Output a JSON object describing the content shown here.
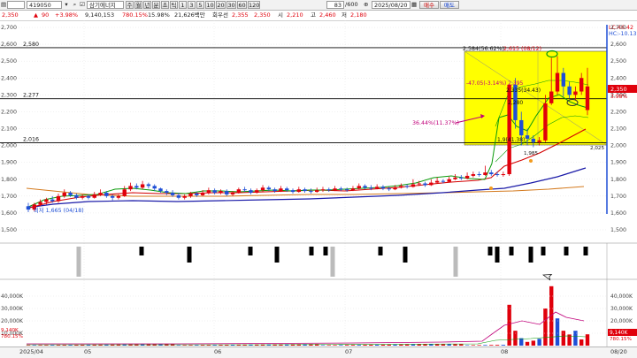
{
  "toolbar": {
    "prefix": "",
    "code": "419050",
    "name": "삼기에너지",
    "period_buttons": [
      "주",
      "월",
      "년",
      "분",
      "초",
      "틱",
      "1",
      "3",
      "5",
      "10",
      "20",
      "30",
      "60",
      "120"
    ],
    "count_value": "83",
    "count_total": "/600",
    "date_value": "2025/08/20",
    "buy_label": "매수",
    "sell_label": "매도",
    "search_icon": "search-icon",
    "calendar_icon": "calendar-icon"
  },
  "infobar": {
    "price": "2,350",
    "change_sign": "▲",
    "change": "90",
    "change_pct": "+3.98%",
    "volume": "9,140,153",
    "turnover_pct": "780.15%",
    "foreign_pct": "15.98%",
    "amount": "21,626백만",
    "deferred_label": "회우선",
    "deferred_value": "2,355",
    "current": "2,350",
    "open_label": "시",
    "open": "2,210",
    "high_label": "고",
    "high": "2,460",
    "low_label": "저",
    "low": "2,180"
  },
  "indicators": {
    "lc": "LC:46.42",
    "hc": "HC:-10.13"
  },
  "price_axis": {
    "ticks": [
      "2,700",
      "2,600",
      "2,500",
      "2,400",
      "2,300",
      "2,200",
      "2,100",
      "2,000",
      "1,900",
      "1,800",
      "1,700",
      "1,600",
      "1,500"
    ],
    "current_label": "2,350",
    "current_pct": "3.98%",
    "low_mark": "2,025"
  },
  "hlines": [
    {
      "label": "2,580",
      "value": 2580
    },
    {
      "label": "2,277",
      "value": 2277
    },
    {
      "label": "2,016",
      "value": 2016
    }
  ],
  "annotations": {
    "peak_a": "2,584(56.62%)",
    "peak_b": "2,615 (08/12)",
    "fib_1": "-47.05(-3.14%) 2,395",
    "fib_2": "2,335(34.43)",
    "fib_3": "2,280",
    "pct_label": "36.44%(11.37%)",
    "box_low": "1,9(41.38)",
    "box_low2": "1,985",
    "low_label": "최저 1,665 (04/18)"
  },
  "volume_axis": {
    "ticks": [
      "40,000K",
      "30,000K",
      "20,000K",
      "10,000K"
    ],
    "left_ticks": [
      "40,000K",
      "30,000K",
      "20,000K",
      "10,000K"
    ],
    "current_value": "9,140K",
    "current_pct": "780.15%"
  },
  "x_axis": {
    "labels": [
      "2025/04",
      "05",
      "06",
      "07",
      "08",
      "08/20"
    ]
  },
  "colors": {
    "up": "#e0000b",
    "down": "#1f4fd6",
    "highlight": "#ffff00",
    "ma5": "#0a9b0a",
    "ma20": "#d40000",
    "ma60": "#0000c8",
    "ma120": "#d47a1e"
  }
}
